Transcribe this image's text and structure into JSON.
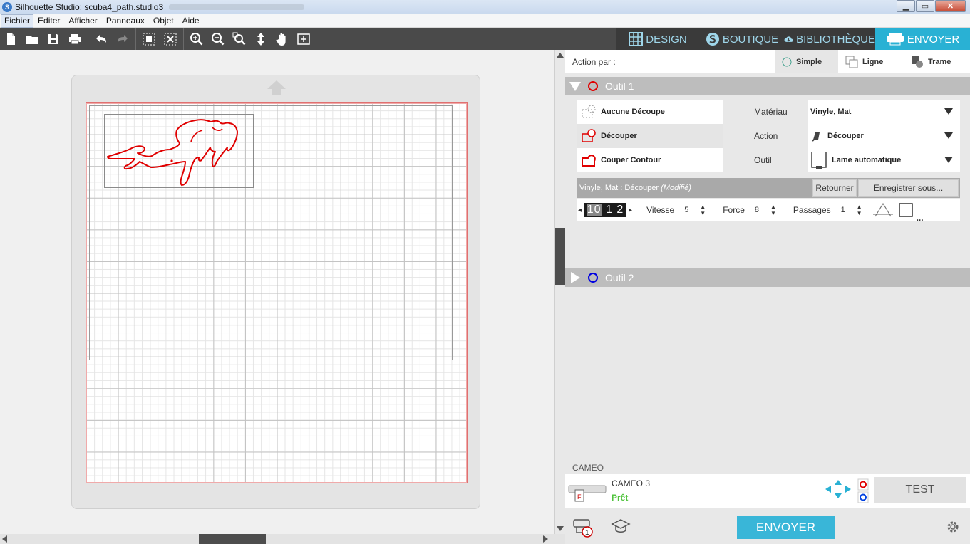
{
  "window": {
    "title": "Silhouette Studio: scuba4_path.studio3"
  },
  "menu": {
    "items": [
      "Fichier",
      "Editer",
      "Afficher",
      "Panneaux",
      "Objet",
      "Aide"
    ]
  },
  "tabs": [
    {
      "label": "DESIGN"
    },
    {
      "label": "BOUTIQUE"
    },
    {
      "label": "BIBLIOTHÈQUE"
    },
    {
      "label": "ENVOYER"
    }
  ],
  "action": {
    "label": "Action par :",
    "options": [
      "Simple",
      "Ligne",
      "Trame"
    ],
    "selected": "Simple"
  },
  "tool1": {
    "label": "Outil 1",
    "color": "#e00000",
    "modes": [
      "Aucune Découpe",
      "Découper",
      "Couper Contour"
    ],
    "selected_mode": "Découper",
    "props": {
      "material_label": "Matériau",
      "material_value": "Vinyle, Mat",
      "action_label": "Action",
      "action_value": "Découper",
      "tool_label": "Outil",
      "tool_value": "Lame automatique"
    },
    "settings_name": "Vinyle, Mat : Découper",
    "settings_modified": "(Modifié)",
    "return_label": "Retourner",
    "save_label": "Enregistrer sous...",
    "blade_values": [
      "10",
      "1",
      "2"
    ],
    "speed_label": "Vitesse",
    "speed": "5",
    "force_label": "Force",
    "force": "8",
    "passes_label": "Passages",
    "passes": "1",
    "more": "..."
  },
  "tool2": {
    "label": "Outil 2",
    "color": "#0000e0"
  },
  "machine": {
    "section": "CAMEO",
    "name": "CAMEO 3",
    "status": "Prêt",
    "test_label": "TEST",
    "send_label": "ENVOYER",
    "status_color": "#4fc33c",
    "queue_count": "1"
  },
  "colors": {
    "accent": "#29b1d4",
    "cut_line": "#e00000"
  }
}
